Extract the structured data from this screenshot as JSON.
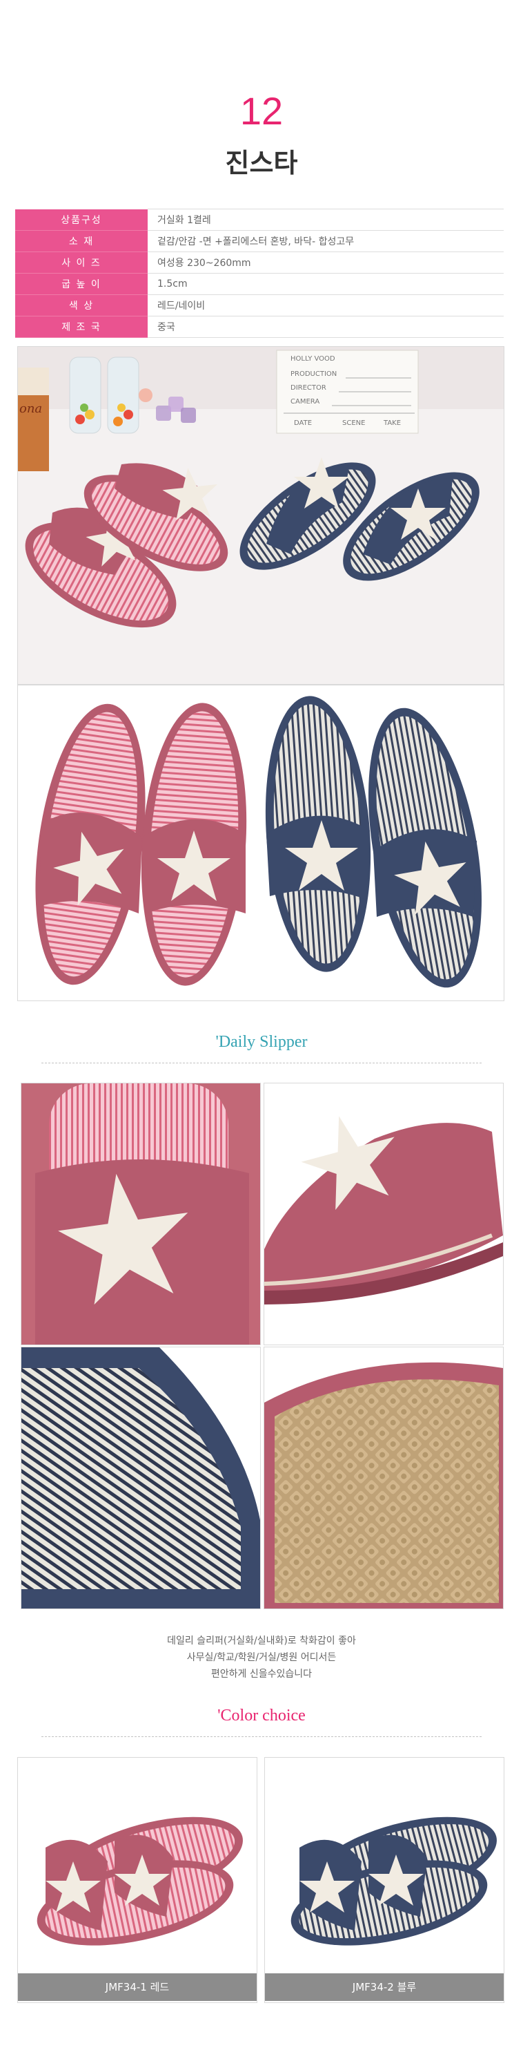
{
  "product": {
    "number": "12",
    "name": "진스타"
  },
  "specs": [
    {
      "label": "상품구성",
      "value": "거실화 1켤레"
    },
    {
      "label": "소       재",
      "value": "겉감/안감 -면 +폴리에스터 혼방,  바닥- 합성고무"
    },
    {
      "label": "사 이 즈",
      "value": "여성용 230~260mm"
    },
    {
      "label": "굽 높 이",
      "value": "1.5cm"
    },
    {
      "label": "색       상",
      "value": "레드/네이비"
    },
    {
      "label": "제 조 국",
      "value": "중국"
    }
  ],
  "clapperboard": {
    "title": "HOLLY VOOD",
    "rows": [
      "PRODUCTION",
      "DIRECTOR",
      "CAMERA"
    ],
    "footer": [
      "DATE",
      "SCENE",
      "TAKE"
    ]
  },
  "jar_label": "ona",
  "daily_section": {
    "title": "'Daily Slipper",
    "description": [
      "데일리 슬리퍼(거실화/실내화)로 착화감이 좋아",
      "사무실/학교/학원/거실/병원 어디서든",
      "편안하게 신을수있습니다"
    ]
  },
  "color_section": {
    "title": "'Color choice",
    "options": [
      {
        "caption": "JMF34-1 레드",
        "color": "#b65b6e"
      },
      {
        "caption": "JMF34-2 블루",
        "color": "#3b4a6b"
      }
    ]
  },
  "colors": {
    "accent": "#e8246f",
    "spec_label_bg": "#ea5390",
    "section_title": "#35a3b3",
    "red_slipper": "#b65b6e",
    "navy_slipper": "#3b4a6b",
    "caption_bg": "#8c8c8c"
  }
}
